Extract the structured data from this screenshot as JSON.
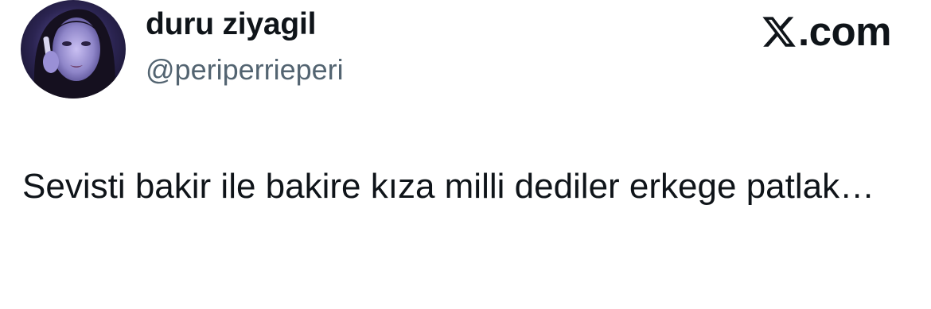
{
  "tweet": {
    "author": {
      "display_name": "duru ziyagil",
      "handle": "@periperrieperi",
      "avatar": "profile-photo"
    },
    "brand": {
      "icon": "x-logo-icon",
      "text": ".com"
    },
    "text": "Sevisti bakir ile bakire kıza milli dediler erkege patlak…"
  }
}
